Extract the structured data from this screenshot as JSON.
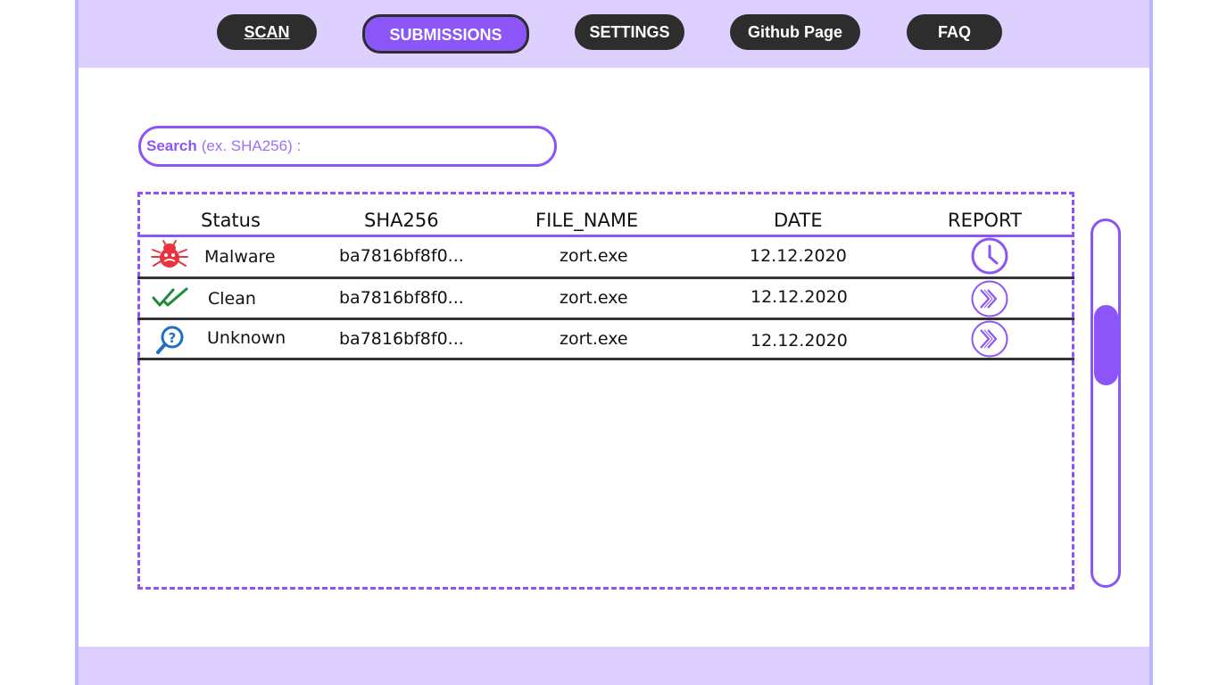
{
  "nav": {
    "scan": "SCAN",
    "submissions": "SUBMISSIONS",
    "settings": "SETTINGS",
    "github": "Github Page",
    "faq": "FAQ"
  },
  "search": {
    "label": "Search",
    "placeholder": "(ex. SHA256) :"
  },
  "table": {
    "headers": {
      "status": "Status",
      "sha256": "SHA256",
      "file_name": "FILE_NAME",
      "date": "DATE",
      "report": "REPORT"
    },
    "rows": [
      {
        "status": "Malware",
        "status_icon": "bug-icon",
        "sha256": "ba7816bf8f0...",
        "file_name": "zort.exe",
        "date": "12.12.2020",
        "report_icon": "clock-icon"
      },
      {
        "status": "Clean",
        "status_icon": "double-check-icon",
        "sha256": "ba7816bf8f0...",
        "file_name": "zort.exe",
        "date": "12.12.2020",
        "report_icon": "double-chevron-right-icon"
      },
      {
        "status": "Unknown",
        "status_icon": "search-question-icon",
        "sha256": "ba7816bf8f0...",
        "file_name": "zort.exe",
        "date": "12.12.2020",
        "report_icon": "double-chevron-right-icon"
      }
    ]
  },
  "colors": {
    "accent": "#8b55f7",
    "header_bg": "#ddd0ff",
    "nav_dark": "#2d2d2d",
    "malware": "#e8343f",
    "clean": "#1f8a3c",
    "unknown": "#1f6fc2"
  }
}
